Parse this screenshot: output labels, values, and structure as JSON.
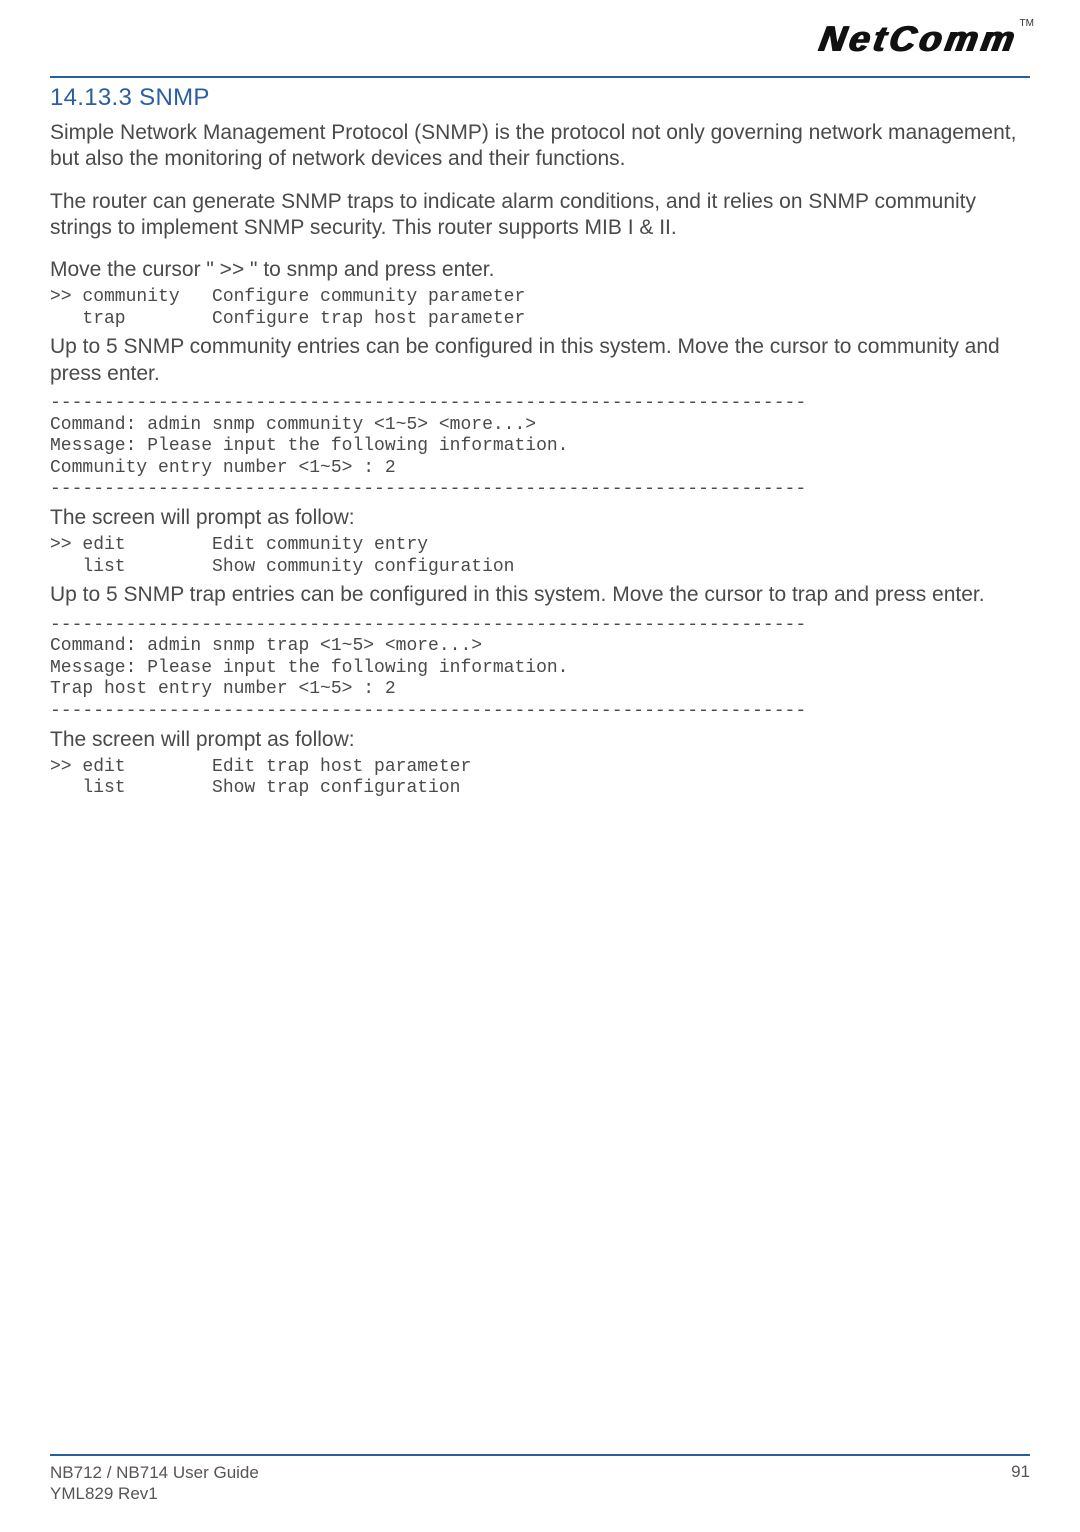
{
  "logo": {
    "brand": "NetComm",
    "tm": "TM"
  },
  "section": {
    "heading": "14.13.3 SNMP"
  },
  "p1": "Simple Network Management Protocol (SNMP) is the protocol not only governing network management, but also the monitoring of network devices and their functions.",
  "p2": "The router can generate SNMP traps to indicate alarm conditions, and it relies on SNMP community strings to implement SNMP security. This router supports MIB I & II.",
  "p3": "Move the cursor \" >> \" to snmp and press enter.",
  "code1": ">> community   Configure community parameter\n   trap        Configure trap host parameter",
  "p4": "Up to 5 SNMP community entries can be configured in this system. Move the cursor to community and press enter.",
  "code2": "----------------------------------------------------------------------\nCommand: admin snmp community <1~5> <more...>\nMessage: Please input the following information.\nCommunity entry number <1~5> : 2\n----------------------------------------------------------------------",
  "p5": "The screen will prompt as follow:",
  "code3": ">> edit        Edit community entry\n   list        Show community configuration",
  "p6": "Up to 5 SNMP trap entries can be configured in this system. Move the cursor to trap and press enter.",
  "code4": "----------------------------------------------------------------------\nCommand: admin snmp trap <1~5> <more...>\nMessage: Please input the following information.\nTrap host entry number <1~5> : 2\n----------------------------------------------------------------------",
  "p7": "The screen will prompt as follow:",
  "code5": ">> edit        Edit trap host parameter\n   list        Show trap configuration",
  "footer": {
    "guide": "NB712 / NB714 User Guide",
    "rev": "YML829 Rev1",
    "page": "91"
  }
}
